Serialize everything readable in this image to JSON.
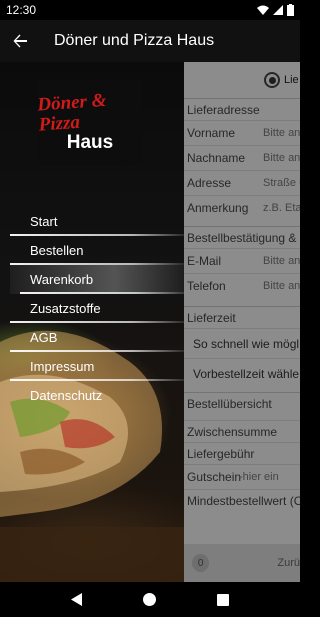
{
  "status_bar": {
    "time": "12:30",
    "icons": [
      "wifi-icon",
      "signal-icon",
      "battery-icon"
    ]
  },
  "app_bar": {
    "title": "Döner und Pizza Haus",
    "back_icon": "arrow-back-icon"
  },
  "drawer": {
    "logo": {
      "line1": "Döner & Pizza",
      "line2": "Haus"
    },
    "items": [
      {
        "label": "Start",
        "active": false
      },
      {
        "label": "Bestellen",
        "active": false
      },
      {
        "label": "Warenkorb",
        "active": true
      },
      {
        "label": "Zusatzstoffe",
        "active": false
      },
      {
        "label": "AGB",
        "active": false
      },
      {
        "label": "Impressum",
        "active": false
      },
      {
        "label": "Datenschutz",
        "active": false
      }
    ]
  },
  "form": {
    "delivery_option": "Lie",
    "address_section": "Lieferadresse",
    "fields": [
      {
        "label": "Vorname",
        "placeholder": "Bitte ang"
      },
      {
        "label": "Nachname",
        "placeholder": "Bitte ang"
      },
      {
        "label": "Adresse",
        "placeholder": "Straße u"
      },
      {
        "label": "Anmerkung",
        "placeholder": "z.B. Etag"
      }
    ],
    "confirm_section": "Bestellbestätigung &",
    "contact_fields": [
      {
        "label": "E-Mail",
        "placeholder": "Bitte ang"
      },
      {
        "label": "Telefon",
        "placeholder": "Bitte ang"
      }
    ],
    "time_section": "Lieferzeit",
    "time_options": [
      "So schnell wie mögl",
      "Vorbestellzeit wähle"
    ],
    "overview_section": "Bestellübersicht",
    "summary": {
      "subtotal": "Zwischensumme",
      "delivery_fee": "Liefergebühr",
      "voucher_label": "Gutschein",
      "voucher_placeholder": "-hier ein",
      "minimum": "Mindestbestellwert (O"
    },
    "cart": {
      "count": "0",
      "label": "Zurü"
    }
  },
  "nav_bar": {
    "icons": [
      "back-triangle-icon",
      "home-circle-icon",
      "recents-square-icon"
    ]
  },
  "colors": {
    "logo_red": "#d11b1b",
    "app_bar": "#111111",
    "drawer_bg": "#0b0b0b"
  }
}
